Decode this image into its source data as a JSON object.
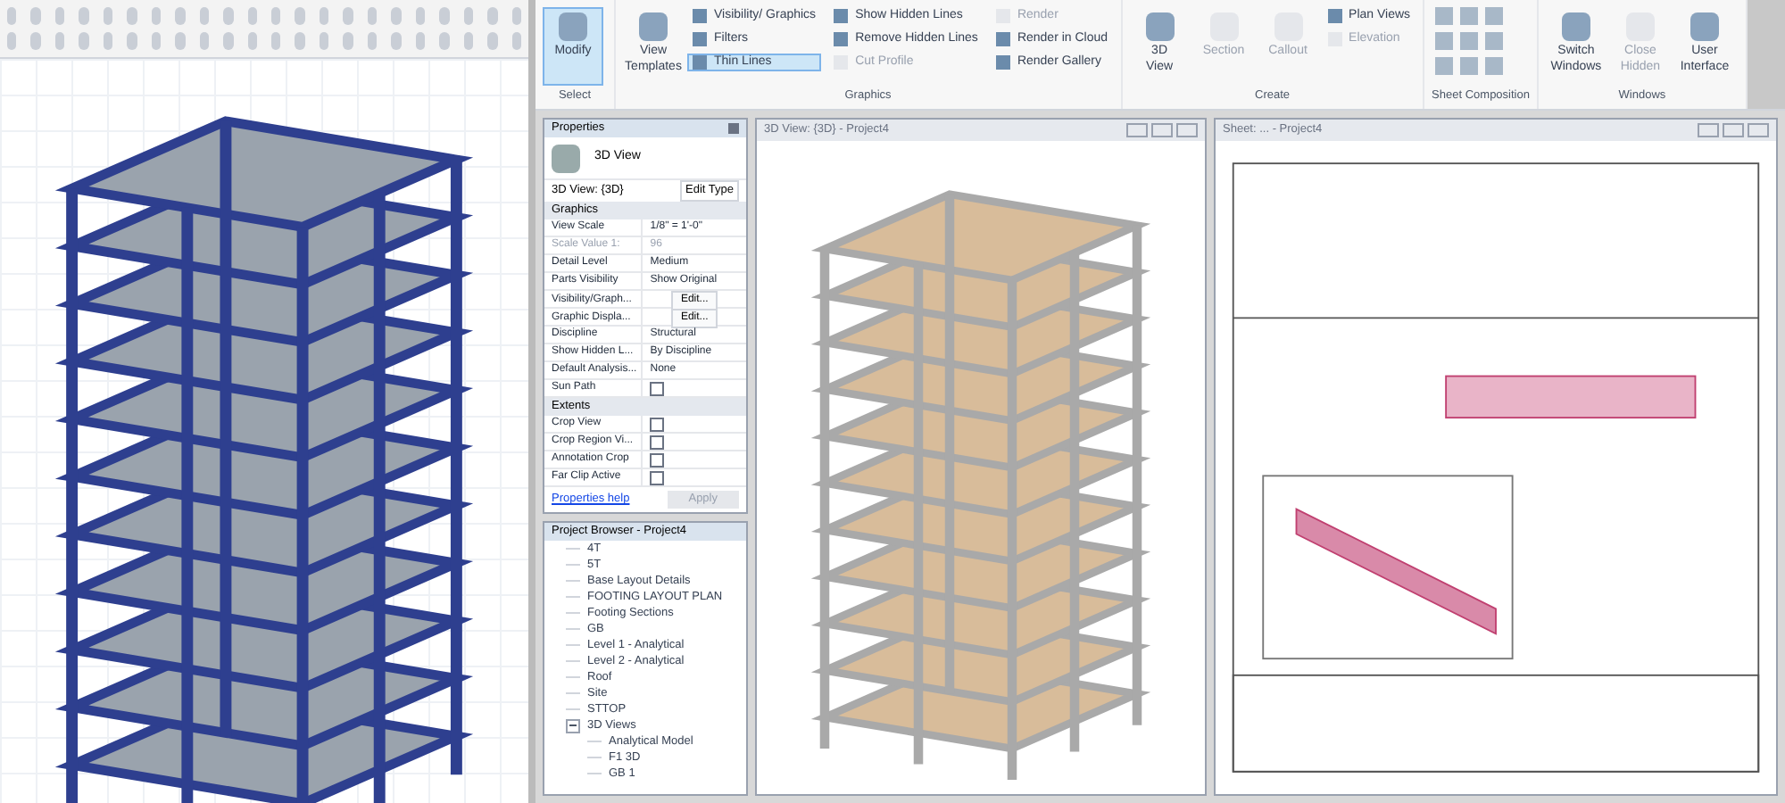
{
  "ribbon": {
    "groups": [
      {
        "label": "Select",
        "tools": [
          {
            "label": "Modify",
            "kind": "large",
            "selected": true,
            "disabled": false
          }
        ]
      },
      {
        "label": "Graphics",
        "tools": [
          {
            "label": "View Templates",
            "kind": "large",
            "selected": false,
            "disabled": false
          },
          {
            "label": "Visibility/ Graphics",
            "kind": "small",
            "selected": false,
            "disabled": false
          },
          {
            "label": "Filters",
            "kind": "small",
            "selected": false,
            "disabled": false
          },
          {
            "label": "Thin Lines",
            "kind": "small",
            "selected": true,
            "disabled": false
          },
          {
            "label": "Show Hidden Lines",
            "kind": "small",
            "selected": false,
            "disabled": false
          },
          {
            "label": "Remove Hidden Lines",
            "kind": "small",
            "selected": false,
            "disabled": false
          },
          {
            "label": "Cut Profile",
            "kind": "small",
            "selected": false,
            "disabled": true
          },
          {
            "label": "Render",
            "kind": "small",
            "selected": false,
            "disabled": true
          },
          {
            "label": "Render in Cloud",
            "kind": "small",
            "selected": false,
            "disabled": false
          },
          {
            "label": "Render Gallery",
            "kind": "small",
            "selected": false,
            "disabled": false
          }
        ]
      },
      {
        "label": "Create",
        "tools": [
          {
            "label": "3D View",
            "kind": "large",
            "selected": false,
            "disabled": false
          },
          {
            "label": "Section",
            "kind": "large",
            "selected": false,
            "disabled": true
          },
          {
            "label": "Callout",
            "kind": "large",
            "selected": false,
            "disabled": true
          },
          {
            "label": "Plan Views",
            "kind": "small",
            "selected": false,
            "disabled": false
          },
          {
            "label": "Elevation",
            "kind": "small",
            "selected": false,
            "disabled": true
          }
        ]
      },
      {
        "label": "Sheet Composition"
      },
      {
        "label": "Windows",
        "tools": [
          {
            "label": "Switch Windows",
            "kind": "large",
            "selected": false,
            "disabled": false
          },
          {
            "label": "Close Hidden",
            "kind": "large",
            "selected": false,
            "disabled": true
          },
          {
            "label": "User Interface",
            "kind": "large",
            "selected": false,
            "disabled": false
          }
        ]
      }
    ]
  },
  "properties": {
    "title": "Properties",
    "type_name": "3D View",
    "view_selector": "3D View: {3D}",
    "edit_type": "Edit Type",
    "sections": [
      {
        "label": "Graphics",
        "rows": [
          {
            "name": "View Scale",
            "value": "1/8\" = 1'-0\"",
            "kind": "text",
            "disabled": false
          },
          {
            "name": "Scale Value    1:",
            "value": "96",
            "kind": "text",
            "disabled": true
          },
          {
            "name": "Detail Level",
            "value": "Medium",
            "kind": "text",
            "disabled": false
          },
          {
            "name": "Parts Visibility",
            "value": "Show Original",
            "kind": "text",
            "disabled": false
          },
          {
            "name": "Visibility/Graph...",
            "value": "Edit...",
            "kind": "button",
            "disabled": false
          },
          {
            "name": "Graphic Displa...",
            "value": "Edit...",
            "kind": "button",
            "disabled": false
          },
          {
            "name": "Discipline",
            "value": "Structural",
            "kind": "text",
            "disabled": false
          },
          {
            "name": "Show Hidden L...",
            "value": "By Discipline",
            "kind": "text",
            "disabled": false
          },
          {
            "name": "Default Analysis...",
            "value": "None",
            "kind": "text",
            "disabled": false
          },
          {
            "name": "Sun Path",
            "kind": "checkbox",
            "checked": false,
            "disabled": false
          }
        ]
      },
      {
        "label": "Extents",
        "rows": [
          {
            "name": "Crop View",
            "kind": "checkbox",
            "checked": false,
            "disabled": false
          },
          {
            "name": "Crop Region Vi...",
            "kind": "checkbox",
            "checked": false,
            "disabled": false
          },
          {
            "name": "Annotation Crop",
            "kind": "checkbox",
            "checked": false,
            "disabled": false
          },
          {
            "name": "Far Clip Active",
            "kind": "checkbox",
            "checked": false,
            "disabled": false
          }
        ]
      }
    ],
    "help_link": "Properties help",
    "apply": "Apply"
  },
  "project_browser": {
    "title": "Project Browser - Project4",
    "items": [
      {
        "label": "4T"
      },
      {
        "label": "5T"
      },
      {
        "label": "Base Layout Details"
      },
      {
        "label": "FOOTING LAYOUT PLAN"
      },
      {
        "label": "Footing Sections"
      },
      {
        "label": "GB"
      },
      {
        "label": "Level 1 - Analytical"
      },
      {
        "label": "Level 2 - Analytical"
      },
      {
        "label": "Roof"
      },
      {
        "label": "Site"
      },
      {
        "label": "STTOP"
      },
      {
        "label": "3D Views",
        "expanded": true,
        "children": [
          {
            "label": "Analytical Model"
          },
          {
            "label": "F1 3D"
          },
          {
            "label": "GB 1"
          }
        ]
      }
    ]
  },
  "view_windows": [
    {
      "title": "3D View: {3D} - Project4"
    },
    {
      "title": "Sheet: ... - Project4"
    }
  ]
}
